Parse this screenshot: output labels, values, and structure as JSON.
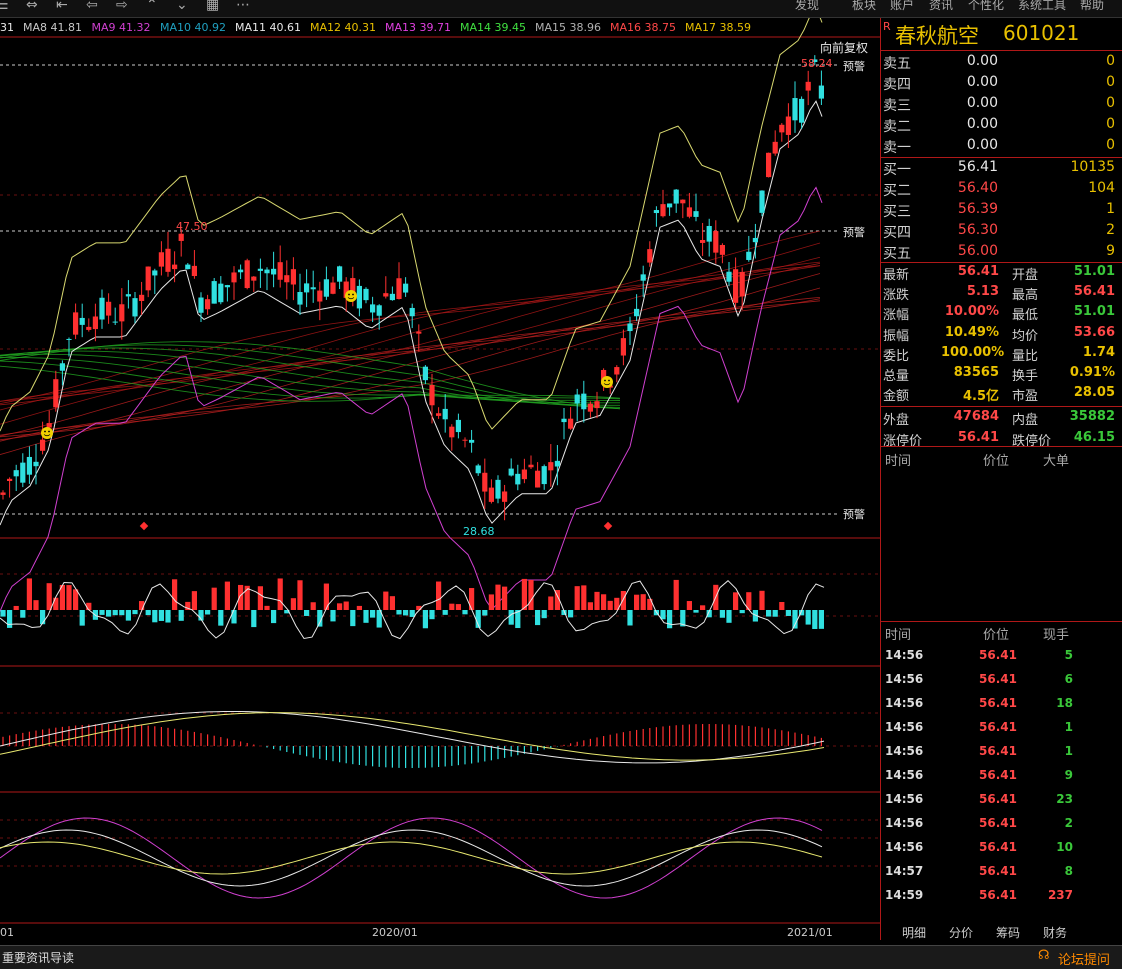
{
  "toolbar": {
    "icons": [
      "menu-icon",
      "fullscreen-icon",
      "first-icon",
      "back-icon",
      "forward-icon",
      "collapse-icon",
      "expand-icon",
      "grid-icon",
      "more-icon"
    ],
    "menu": [
      "发现",
      "板块",
      "账户",
      "资讯",
      "个性化",
      "系统工具",
      "帮助"
    ]
  },
  "ma_legend": [
    {
      "label": "31",
      "color": "#e8e8e8"
    },
    {
      "label": "MA8 41.81",
      "color": "#c8c8c8"
    },
    {
      "label": "MA9 41.32",
      "color": "#d040d0"
    },
    {
      "label": "MA10 40.92",
      "color": "#20a0c0"
    },
    {
      "label": "MA11 40.61",
      "color": "#e8e8e8"
    },
    {
      "label": "MA12 40.31",
      "color": "#e8c000"
    },
    {
      "label": "MA13 39.71",
      "color": "#e040e0"
    },
    {
      "label": "MA14 39.45",
      "color": "#40e040"
    },
    {
      "label": "MA15 38.96",
      "color": "#b0b0b0"
    },
    {
      "label": "MA16 38.75",
      "color": "#ff4848"
    },
    {
      "label": "MA17 38.59",
      "color": "#e8c000"
    }
  ],
  "chart": {
    "restore_label": "向前复权",
    "high_label": "58.24",
    "peak_label": "47.50",
    "low_label": "28.68",
    "alert_label": "预警",
    "date_labels": [
      "01",
      "2020/01",
      "2021/01"
    ]
  },
  "stock": {
    "name": "春秋航空",
    "code": "601021",
    "badge": "R"
  },
  "quotes": {
    "sell": [
      {
        "label": "卖五",
        "price": "0.00",
        "vol": "0"
      },
      {
        "label": "卖四",
        "price": "0.00",
        "vol": "0"
      },
      {
        "label": "卖三",
        "price": "0.00",
        "vol": "0"
      },
      {
        "label": "卖二",
        "price": "0.00",
        "vol": "0"
      },
      {
        "label": "卖一",
        "price": "0.00",
        "vol": "0"
      }
    ],
    "buy": [
      {
        "label": "买一",
        "price": "56.41",
        "vol": "10135"
      },
      {
        "label": "买二",
        "price": "56.40",
        "vol": "104"
      },
      {
        "label": "买三",
        "price": "56.39",
        "vol": "1"
      },
      {
        "label": "买四",
        "price": "56.30",
        "vol": "2"
      },
      {
        "label": "买五",
        "price": "56.00",
        "vol": "9"
      }
    ]
  },
  "stats": [
    {
      "l1": "最新",
      "v1": "56.41",
      "c1": "red",
      "l2": "开盘",
      "v2": "51.01",
      "c2": "green"
    },
    {
      "l1": "涨跌",
      "v1": "5.13",
      "c1": "red",
      "l2": "最高",
      "v2": "56.41",
      "c2": "red"
    },
    {
      "l1": "涨幅",
      "v1": "10.00%",
      "c1": "red",
      "l2": "最低",
      "v2": "51.01",
      "c2": "green"
    },
    {
      "l1": "振幅",
      "v1": "10.49%",
      "c1": "yellow",
      "l2": "均价",
      "v2": "53.66",
      "c2": "red"
    },
    {
      "l1": "委比",
      "v1": "100.00%",
      "c1": "yellow",
      "l2": "量比",
      "v2": "1.74",
      "c2": "yellow"
    },
    {
      "l1": "总量",
      "v1": "83565",
      "c1": "yellow",
      "l2": "换手",
      "v2": "0.91%",
      "c2": "yellow"
    },
    {
      "l1": "金额",
      "v1": "4.5亿",
      "c1": "yellow",
      "l2": "市盈",
      "v2": "28.05",
      "c2": "yellow"
    },
    {
      "l1": "外盘",
      "v1": "47684",
      "c1": "red",
      "l2": "内盘",
      "v2": "35882",
      "c2": "green"
    },
    {
      "l1": "涨停价",
      "v1": "56.41",
      "c1": "red",
      "l2": "跌停价",
      "v2": "46.15",
      "c2": "green"
    }
  ],
  "big_orders": {
    "col1": "时间",
    "col2": "价位",
    "col3": "大单"
  },
  "ticks_header": {
    "col1": "时间",
    "col2": "价位",
    "col3": "现手"
  },
  "ticks": [
    {
      "time": "14:56",
      "price": "56.41",
      "vol": "5",
      "vc": "green"
    },
    {
      "time": "14:56",
      "price": "56.41",
      "vol": "6",
      "vc": "green"
    },
    {
      "time": "14:56",
      "price": "56.41",
      "vol": "18",
      "vc": "green"
    },
    {
      "time": "14:56",
      "price": "56.41",
      "vol": "1",
      "vc": "green"
    },
    {
      "time": "14:56",
      "price": "56.41",
      "vol": "1",
      "vc": "green"
    },
    {
      "time": "14:56",
      "price": "56.41",
      "vol": "9",
      "vc": "green"
    },
    {
      "time": "14:56",
      "price": "56.41",
      "vol": "23",
      "vc": "green"
    },
    {
      "time": "14:56",
      "price": "56.41",
      "vol": "2",
      "vc": "green"
    },
    {
      "time": "14:56",
      "price": "56.41",
      "vol": "10",
      "vc": "green"
    },
    {
      "time": "14:57",
      "price": "56.41",
      "vol": "8",
      "vc": "green"
    },
    {
      "time": "14:59",
      "price": "56.41",
      "vol": "237",
      "vc": "red"
    }
  ],
  "tabs": [
    "明细",
    "分价",
    "筹码",
    "财务"
  ],
  "status": {
    "left": "重要资讯导读",
    "right": "论坛提问"
  },
  "colors": {
    "up": "#ff3030",
    "down": "#30e0e0",
    "accent": "#e8c000",
    "border": "#b01818"
  }
}
